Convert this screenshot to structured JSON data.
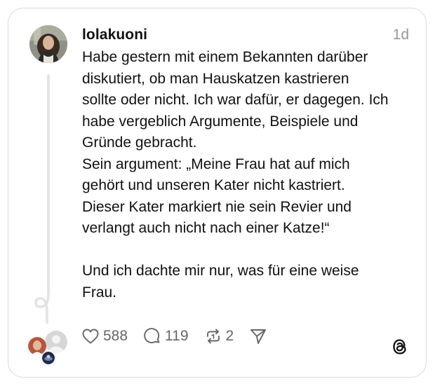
{
  "post": {
    "username": "lolakuoni",
    "timestamp": "1d",
    "text": "Habe gestern mit einem Bekannten darüber\ndiskutiert, ob man Hauskatzen kastrieren\nsollte oder nicht. Ich war dafür, er dagegen. Ich\nhabe vergeblich Argumente, Beispiele und\nGründe gebracht.\nSein argument: „Meine Frau hat auf mich\ngehört und unseren Kater nicht kastriert.\nDieser Kater markiert nie sein Revier und\nverlangt auch nicht nach einer Katze!“\n\nUnd ich dachte mir nur, was für eine weise\nFrau."
  },
  "actions": {
    "likes": "588",
    "replies": "119",
    "reposts": "2"
  },
  "icons": {
    "like": "heart-icon",
    "reply": "comment-icon",
    "repost": "repost-icon",
    "share": "send-icon",
    "brand": "threads-logo-icon"
  },
  "colors": {
    "text": "#101010",
    "muted": "#999999",
    "icon": "#666666",
    "border": "#d9d9d9",
    "thread_line": "#e3e3e3"
  }
}
